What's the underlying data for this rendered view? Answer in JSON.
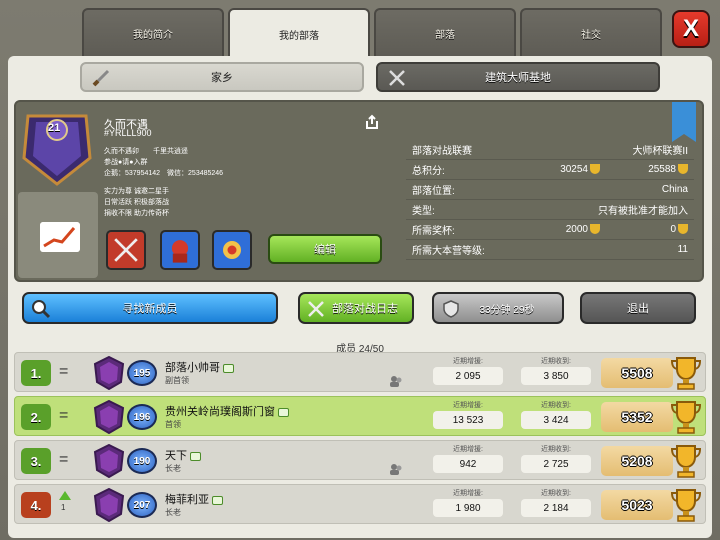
{
  "tabs": [
    {
      "label": "我的简介",
      "active": false
    },
    {
      "label": "我的部落",
      "active": true
    },
    {
      "label": "部落",
      "active": false
    },
    {
      "label": "社交",
      "active": false
    }
  ],
  "close_label": "X",
  "subtabs": {
    "home_label": "家乡",
    "builder_label": "建筑大师基地"
  },
  "clan": {
    "badge_level": "21",
    "name": "久而不遇",
    "tag": "#YRLLL900",
    "desc_line1": "久而不遇卯　　千里共逍遥",
    "desc_line2": "参战●请●入群",
    "desc_line3": "企鹅：537954142　微信：253485246",
    "desc_line4": "实力为尊 诚邀二星手",
    "desc_line5": "日常活跃 积极部落战",
    "desc_line6": "捐收不限 助力传奇杯",
    "edit_label": "编辑"
  },
  "stats": [
    {
      "label": "部落对战联赛",
      "value": "大师杯联赛II"
    },
    {
      "label": "总积分:",
      "value": "30254",
      "value2": "25588"
    },
    {
      "label": "部落位置:",
      "value": "China"
    },
    {
      "label": "类型:",
      "value": "只有被批准才能加入"
    },
    {
      "label": "所需奖杯:",
      "value": "2000",
      "value2": "0"
    },
    {
      "label": "所需大本营等级:",
      "value": "11"
    }
  ],
  "actions": {
    "find_label": "寻找新成员",
    "war_log_label": "部落对战日志",
    "timer_label": "33分钟 29秒",
    "leave_label": "退出"
  },
  "members_count": "成员 24/50",
  "donated_label": "近期增援:",
  "received_label": "近期收到:",
  "members": [
    {
      "rank": "1.",
      "change": "=",
      "level": "195",
      "name": "部落小帅哥",
      "role": "副首领",
      "donated": "2 095",
      "received": "3 850",
      "trophies": "5508"
    },
    {
      "rank": "2.",
      "change": "=",
      "level": "196",
      "name": "贵州关岭尚璞阁斯门窗",
      "role": "首领",
      "donated": "13 523",
      "received": "3 424",
      "trophies": "5352"
    },
    {
      "rank": "3.",
      "change": "=",
      "level": "190",
      "name": "天下",
      "role": "长老",
      "donated": "942",
      "received": "2 725",
      "trophies": "5208"
    },
    {
      "rank": "4.",
      "change": "1",
      "level": "207",
      "name": "梅菲利亚",
      "role": "长老",
      "donated": "1 980",
      "received": "2 184",
      "trophies": "5023"
    }
  ],
  "colors": {
    "accent_green": "#62b124",
    "accent_blue": "#1b80d8",
    "close_red": "#e63a2c",
    "highlight_row": "#bfe07a"
  }
}
